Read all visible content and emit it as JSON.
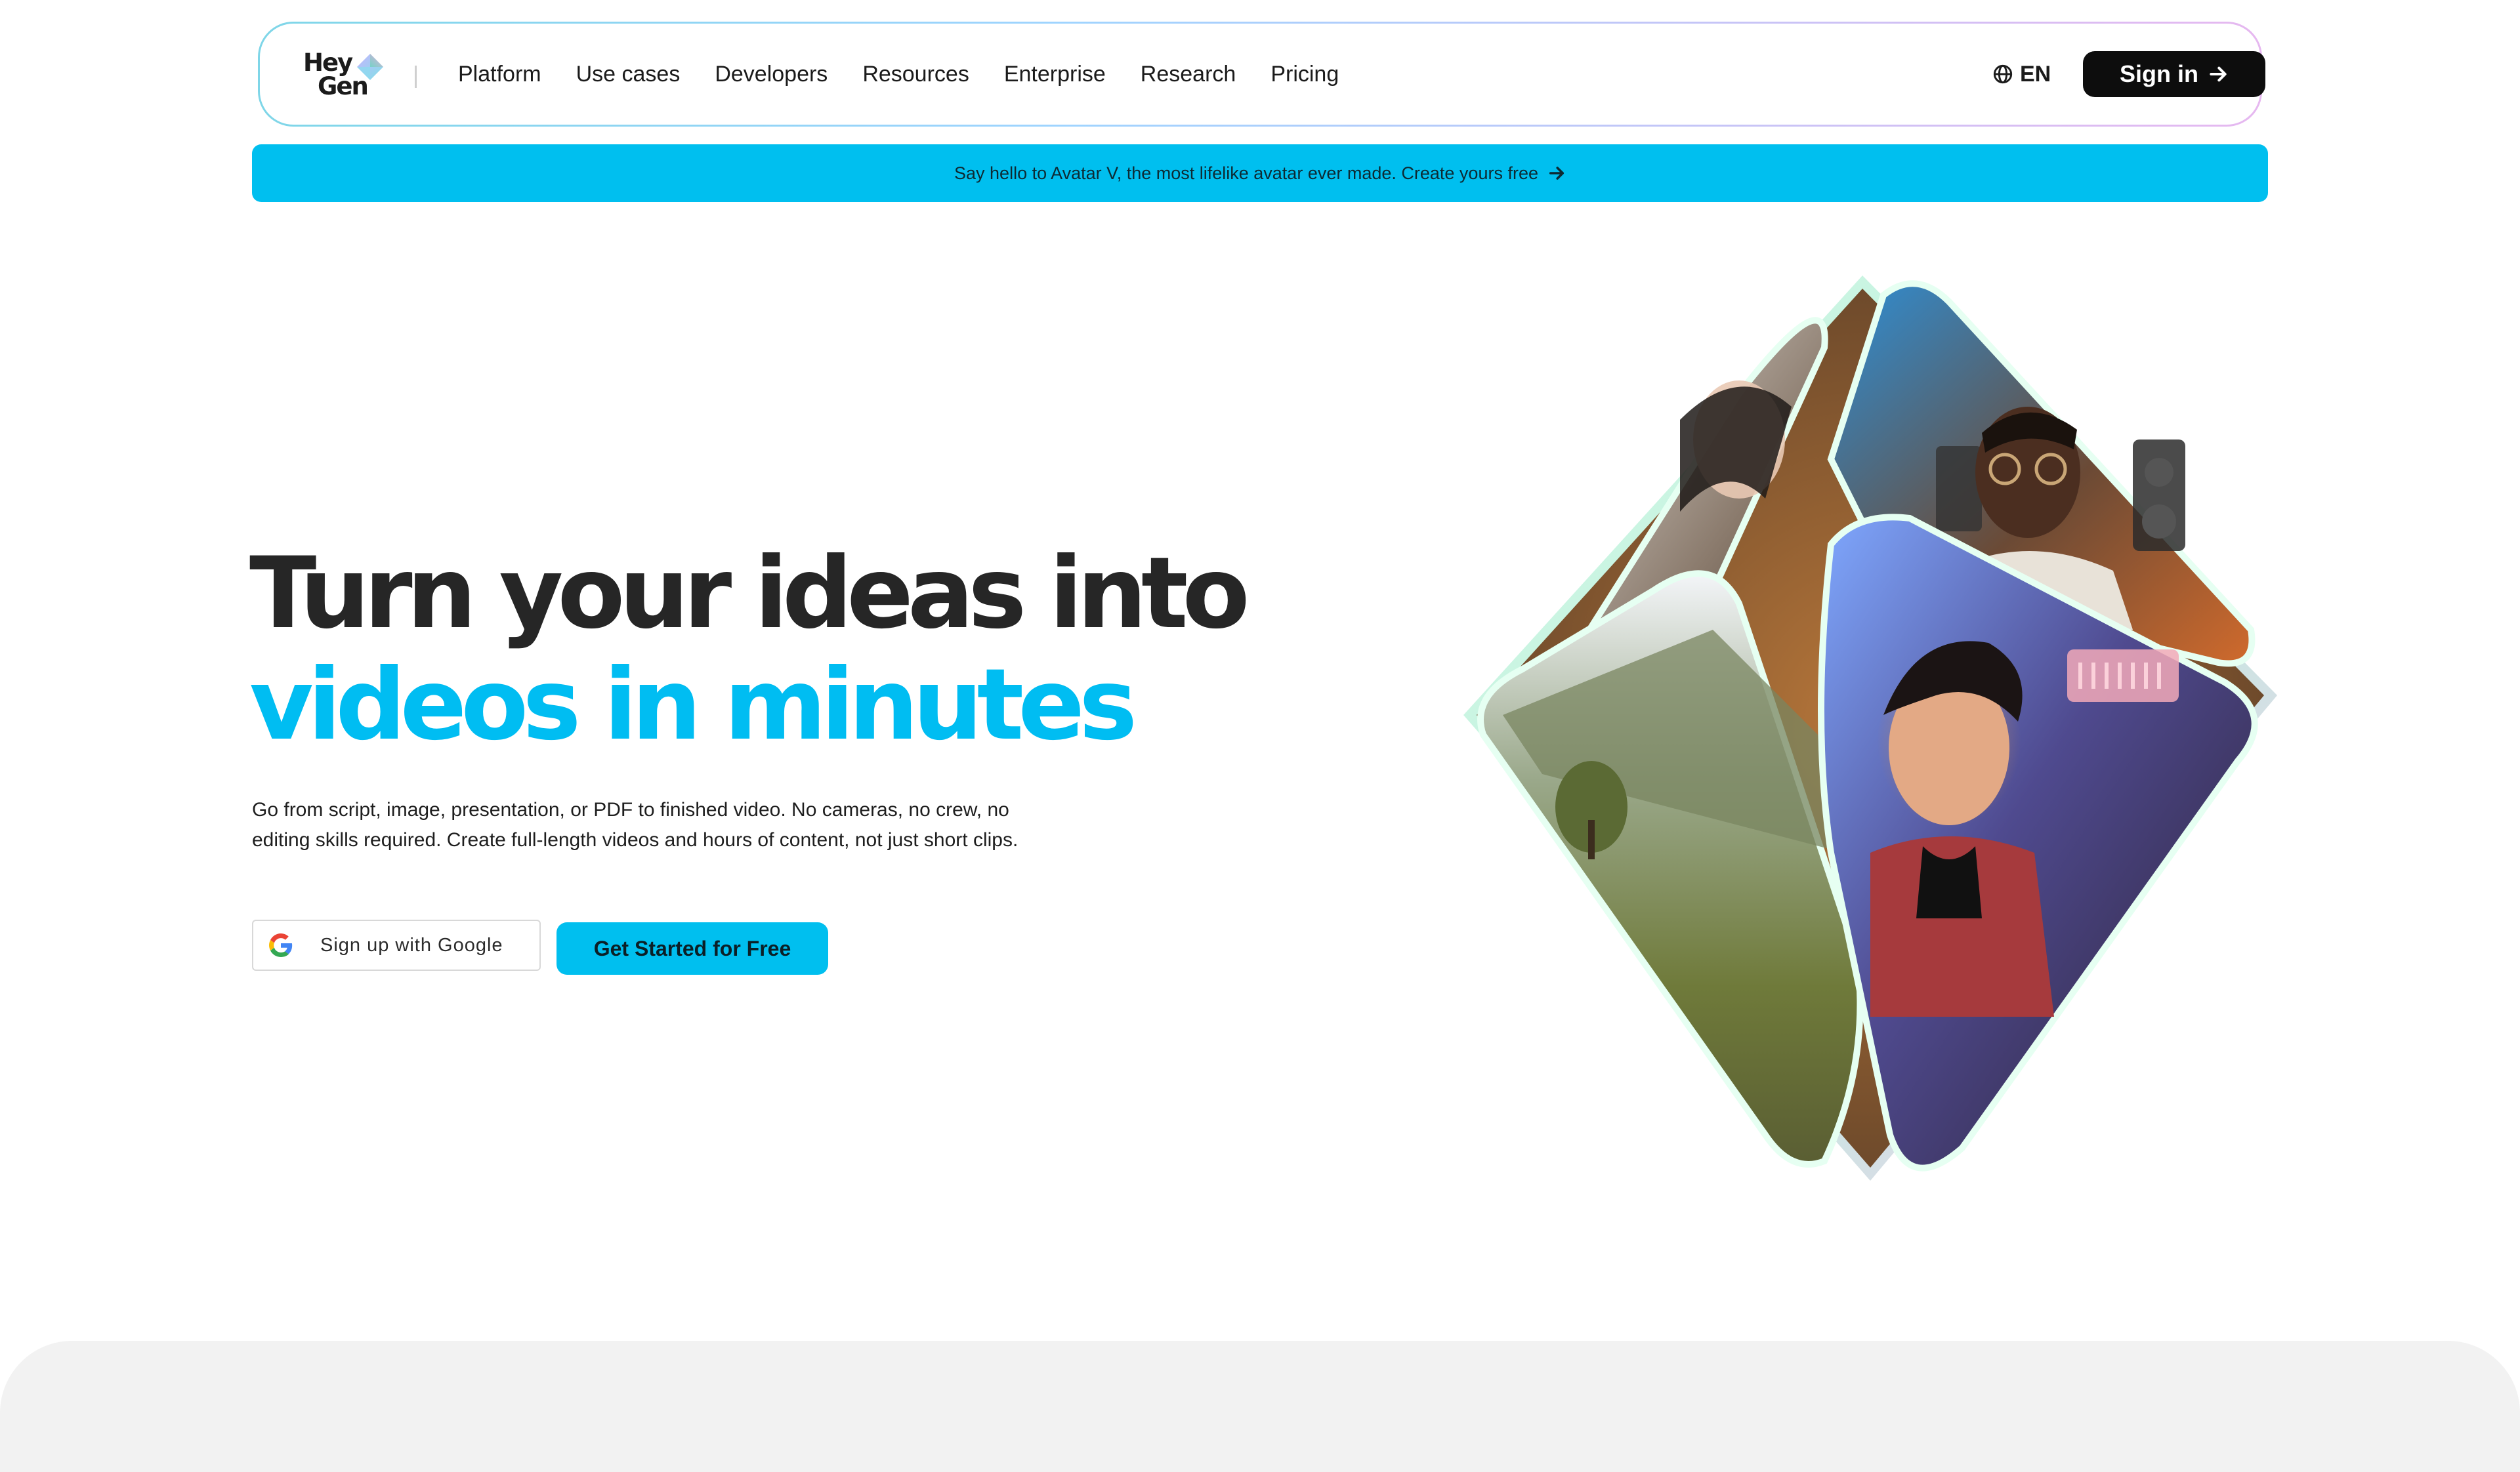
{
  "brand": {
    "logo_line1": "Hey",
    "logo_line2": "Gen"
  },
  "nav": {
    "links": [
      {
        "label": "Platform"
      },
      {
        "label": "Use cases"
      },
      {
        "label": "Developers"
      },
      {
        "label": "Resources"
      },
      {
        "label": "Enterprise"
      },
      {
        "label": "Research"
      },
      {
        "label": "Pricing"
      }
    ],
    "language": "EN",
    "signin_label": "Sign in"
  },
  "banner": {
    "text": "Say hello to Avatar V, the most lifelike avatar ever made. Create yours free"
  },
  "hero": {
    "title_line1": "Turn your ideas into",
    "title_line2": "videos in minutes",
    "description": "Go from script, image, presentation, or PDF to finished video. No cameras, no crew, no editing skills required. Create full-length videos and hours of content, not just short clips.",
    "google_button": "Sign up with Google",
    "cta_button": "Get Started for Free"
  },
  "colors": {
    "accent": "#00bfef",
    "dark": "#0d0d0d",
    "title": "#262626"
  },
  "icons": {
    "logo": "heygen-gem-icon",
    "language": "globe-icon",
    "signin": "arrow-right-icon",
    "banner": "arrow-right-icon",
    "google": "google-g-icon"
  }
}
